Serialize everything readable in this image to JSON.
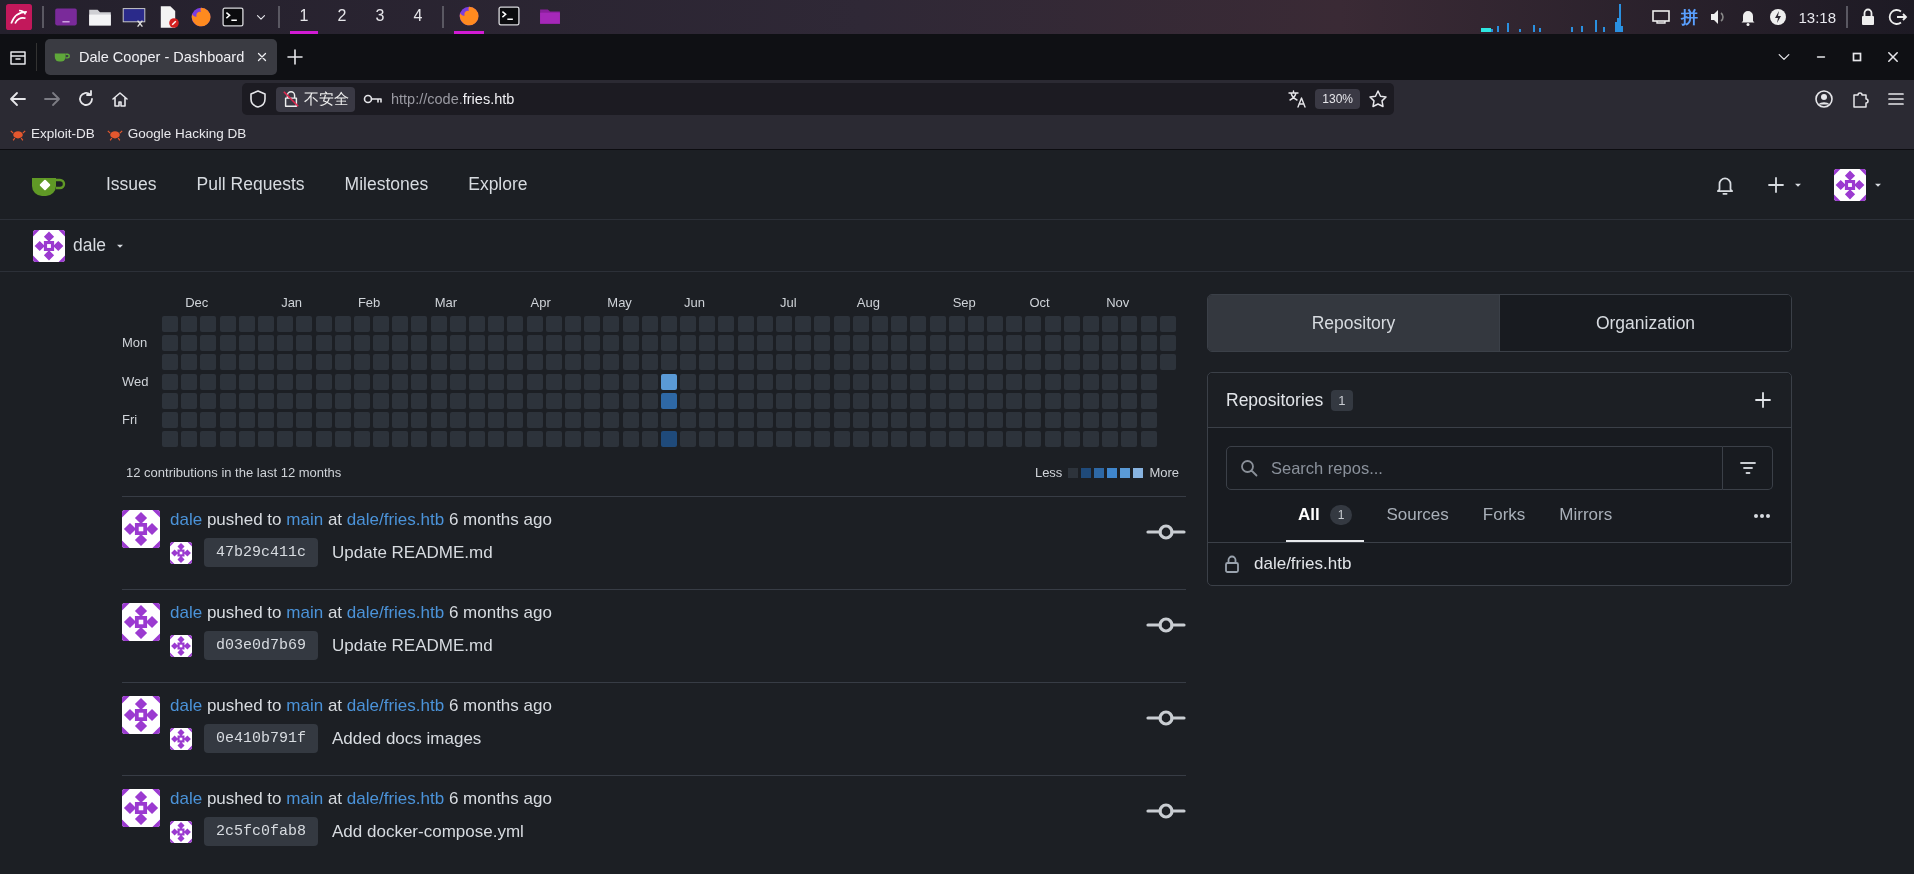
{
  "taskbar": {
    "workspaces": [
      {
        "label": "1",
        "selected": true
      },
      {
        "label": "2",
        "selected": false
      },
      {
        "label": "3",
        "selected": false
      },
      {
        "label": "4",
        "selected": false
      }
    ],
    "windows": [
      {
        "kind": "browser",
        "active": true
      },
      {
        "kind": "terminal",
        "active": false
      },
      {
        "kind": "folder",
        "active": false
      }
    ],
    "ime": "拼",
    "clock": "13:18"
  },
  "browser": {
    "tab_title": "Dale Cooper - Dashboard",
    "forward": {
      "disabled": true
    },
    "security_label": "不安全",
    "url_prefix": "http://code.",
    "url_host": "fries.htb",
    "zoom": "130%",
    "bookmarks": [
      "Exploit-DB",
      "Google Hacking DB"
    ]
  },
  "nav": {
    "items": [
      "Issues",
      "Pull Requests",
      "Milestones",
      "Explore"
    ]
  },
  "context": {
    "user": "dale"
  },
  "heatmap": {
    "day_labels": [
      "Mon",
      "Wed",
      "Fri"
    ],
    "weeks": [
      {
        "days": [
          {
            "color": "#2d333b"
          },
          {
            "color": "#2d333b"
          },
          {
            "color": "#2d333b"
          },
          {
            "color": "#2d333b"
          },
          {
            "color": "#2d333b"
          },
          {
            "color": "#2d333b"
          },
          {
            "color": "#2d333b"
          }
        ]
      },
      {
        "month": "Dec",
        "days": [
          {
            "color": "#2d333b"
          },
          {
            "color": "#2d333b"
          },
          {
            "color": "#2d333b"
          },
          {
            "color": "#2d333b"
          },
          {
            "color": "#2d333b"
          },
          {
            "color": "#2d333b"
          },
          {
            "color": "#2d333b"
          }
        ]
      },
      {
        "days": [
          {
            "color": "#2d333b"
          },
          {
            "color": "#2d333b"
          },
          {
            "color": "#2d333b"
          },
          {
            "color": "#2d333b"
          },
          {
            "color": "#2d333b"
          },
          {
            "color": "#2d333b"
          },
          {
            "color": "#2d333b"
          }
        ]
      },
      {
        "days": [
          {
            "color": "#2d333b"
          },
          {
            "color": "#2d333b"
          },
          {
            "color": "#2d333b"
          },
          {
            "color": "#2d333b"
          },
          {
            "color": "#2d333b"
          },
          {
            "color": "#2d333b"
          },
          {
            "color": "#2d333b"
          }
        ]
      },
      {
        "days": [
          {
            "color": "#2d333b"
          },
          {
            "color": "#2d333b"
          },
          {
            "color": "#2d333b"
          },
          {
            "color": "#2d333b"
          },
          {
            "color": "#2d333b"
          },
          {
            "color": "#2d333b"
          },
          {
            "color": "#2d333b"
          }
        ]
      },
      {
        "days": [
          {
            "color": "#2d333b"
          },
          {
            "color": "#2d333b"
          },
          {
            "color": "#2d333b"
          },
          {
            "color": "#2d333b"
          },
          {
            "color": "#2d333b"
          },
          {
            "color": "#2d333b"
          },
          {
            "color": "#2d333b"
          }
        ]
      },
      {
        "month": "Jan",
        "days": [
          {
            "color": "#2d333b"
          },
          {
            "color": "#2d333b"
          },
          {
            "color": "#2d333b"
          },
          {
            "color": "#2d333b"
          },
          {
            "color": "#2d333b"
          },
          {
            "color": "#2d333b"
          },
          {
            "color": "#2d333b"
          }
        ]
      },
      {
        "days": [
          {
            "color": "#2d333b"
          },
          {
            "color": "#2d333b"
          },
          {
            "color": "#2d333b"
          },
          {
            "color": "#2d333b"
          },
          {
            "color": "#2d333b"
          },
          {
            "color": "#2d333b"
          },
          {
            "color": "#2d333b"
          }
        ]
      },
      {
        "days": [
          {
            "color": "#2d333b"
          },
          {
            "color": "#2d333b"
          },
          {
            "color": "#2d333b"
          },
          {
            "color": "#2d333b"
          },
          {
            "color": "#2d333b"
          },
          {
            "color": "#2d333b"
          },
          {
            "color": "#2d333b"
          }
        ]
      },
      {
        "days": [
          {
            "color": "#2d333b"
          },
          {
            "color": "#2d333b"
          },
          {
            "color": "#2d333b"
          },
          {
            "color": "#2d333b"
          },
          {
            "color": "#2d333b"
          },
          {
            "color": "#2d333b"
          },
          {
            "color": "#2d333b"
          }
        ]
      },
      {
        "month": "Feb",
        "days": [
          {
            "color": "#2d333b"
          },
          {
            "color": "#2d333b"
          },
          {
            "color": "#2d333b"
          },
          {
            "color": "#2d333b"
          },
          {
            "color": "#2d333b"
          },
          {
            "color": "#2d333b"
          },
          {
            "color": "#2d333b"
          }
        ]
      },
      {
        "days": [
          {
            "color": "#2d333b"
          },
          {
            "color": "#2d333b"
          },
          {
            "color": "#2d333b"
          },
          {
            "color": "#2d333b"
          },
          {
            "color": "#2d333b"
          },
          {
            "color": "#2d333b"
          },
          {
            "color": "#2d333b"
          }
        ]
      },
      {
        "days": [
          {
            "color": "#2d333b"
          },
          {
            "color": "#2d333b"
          },
          {
            "color": "#2d333b"
          },
          {
            "color": "#2d333b"
          },
          {
            "color": "#2d333b"
          },
          {
            "color": "#2d333b"
          },
          {
            "color": "#2d333b"
          }
        ]
      },
      {
        "days": [
          {
            "color": "#2d333b"
          },
          {
            "color": "#2d333b"
          },
          {
            "color": "#2d333b"
          },
          {
            "color": "#2d333b"
          },
          {
            "color": "#2d333b"
          },
          {
            "color": "#2d333b"
          },
          {
            "color": "#2d333b"
          }
        ]
      },
      {
        "month": "Mar",
        "days": [
          {
            "color": "#2d333b"
          },
          {
            "color": "#2d333b"
          },
          {
            "color": "#2d333b"
          },
          {
            "color": "#2d333b"
          },
          {
            "color": "#2d333b"
          },
          {
            "color": "#2d333b"
          },
          {
            "color": "#2d333b"
          }
        ]
      },
      {
        "days": [
          {
            "color": "#2d333b"
          },
          {
            "color": "#2d333b"
          },
          {
            "color": "#2d333b"
          },
          {
            "color": "#2d333b"
          },
          {
            "color": "#2d333b"
          },
          {
            "color": "#2d333b"
          },
          {
            "color": "#2d333b"
          }
        ]
      },
      {
        "days": [
          {
            "color": "#2d333b"
          },
          {
            "color": "#2d333b"
          },
          {
            "color": "#2d333b"
          },
          {
            "color": "#2d333b"
          },
          {
            "color": "#2d333b"
          },
          {
            "color": "#2d333b"
          },
          {
            "color": "#2d333b"
          }
        ]
      },
      {
        "days": [
          {
            "color": "#2d333b"
          },
          {
            "color": "#2d333b"
          },
          {
            "color": "#2d333b"
          },
          {
            "color": "#2d333b"
          },
          {
            "color": "#2d333b"
          },
          {
            "color": "#2d333b"
          },
          {
            "color": "#2d333b"
          }
        ]
      },
      {
        "days": [
          {
            "color": "#2d333b"
          },
          {
            "color": "#2d333b"
          },
          {
            "color": "#2d333b"
          },
          {
            "color": "#2d333b"
          },
          {
            "color": "#2d333b"
          },
          {
            "color": "#2d333b"
          },
          {
            "color": "#2d333b"
          }
        ]
      },
      {
        "month": "Apr",
        "days": [
          {
            "color": "#2d333b"
          },
          {
            "color": "#2d333b"
          },
          {
            "color": "#2d333b"
          },
          {
            "color": "#2d333b"
          },
          {
            "color": "#2d333b"
          },
          {
            "color": "#2d333b"
          },
          {
            "color": "#2d333b"
          }
        ]
      },
      {
        "days": [
          {
            "color": "#2d333b"
          },
          {
            "color": "#2d333b"
          },
          {
            "color": "#2d333b"
          },
          {
            "color": "#2d333b"
          },
          {
            "color": "#2d333b"
          },
          {
            "color": "#2d333b"
          },
          {
            "color": "#2d333b"
          }
        ]
      },
      {
        "days": [
          {
            "color": "#2d333b"
          },
          {
            "color": "#2d333b"
          },
          {
            "color": "#2d333b"
          },
          {
            "color": "#2d333b"
          },
          {
            "color": "#2d333b"
          },
          {
            "color": "#2d333b"
          },
          {
            "color": "#2d333b"
          }
        ]
      },
      {
        "days": [
          {
            "color": "#2d333b"
          },
          {
            "color": "#2d333b"
          },
          {
            "color": "#2d333b"
          },
          {
            "color": "#2d333b"
          },
          {
            "color": "#2d333b"
          },
          {
            "color": "#2d333b"
          },
          {
            "color": "#2d333b"
          }
        ]
      },
      {
        "month": "May",
        "days": [
          {
            "color": "#2d333b"
          },
          {
            "color": "#2d333b"
          },
          {
            "color": "#2d333b"
          },
          {
            "color": "#2d333b"
          },
          {
            "color": "#2d333b"
          },
          {
            "color": "#2d333b"
          },
          {
            "color": "#2d333b"
          }
        ]
      },
      {
        "days": [
          {
            "color": "#2d333b"
          },
          {
            "color": "#2d333b"
          },
          {
            "color": "#2d333b"
          },
          {
            "color": "#2d333b"
          },
          {
            "color": "#2d333b"
          },
          {
            "color": "#2d333b"
          },
          {
            "color": "#2d333b"
          }
        ]
      },
      {
        "days": [
          {
            "color": "#2d333b"
          },
          {
            "color": "#2d333b"
          },
          {
            "color": "#2d333b"
          },
          {
            "color": "#2d333b"
          },
          {
            "color": "#2d333b"
          },
          {
            "color": "#2d333b"
          },
          {
            "color": "#2d333b"
          }
        ]
      },
      {
        "days": [
          {
            "color": "#2d333b"
          },
          {
            "color": "#2d333b"
          },
          {
            "color": "#2d333b"
          },
          {
            "color": "#5a9ad6"
          },
          {
            "color": "#2e68a5"
          },
          {
            "color": "#2d333b"
          },
          {
            "color": "#1f4a7a"
          }
        ]
      },
      {
        "month": "Jun",
        "days": [
          {
            "color": "#2d333b"
          },
          {
            "color": "#2d333b"
          },
          {
            "color": "#2d333b"
          },
          {
            "color": "#2d333b"
          },
          {
            "color": "#2d333b"
          },
          {
            "color": "#2d333b"
          },
          {
            "color": "#2d333b"
          }
        ]
      },
      {
        "days": [
          {
            "color": "#2d333b"
          },
          {
            "color": "#2d333b"
          },
          {
            "color": "#2d333b"
          },
          {
            "color": "#2d333b"
          },
          {
            "color": "#2d333b"
          },
          {
            "color": "#2d333b"
          },
          {
            "color": "#2d333b"
          }
        ]
      },
      {
        "days": [
          {
            "color": "#2d333b"
          },
          {
            "color": "#2d333b"
          },
          {
            "color": "#2d333b"
          },
          {
            "color": "#2d333b"
          },
          {
            "color": "#2d333b"
          },
          {
            "color": "#2d333b"
          },
          {
            "color": "#2d333b"
          }
        ]
      },
      {
        "days": [
          {
            "color": "#2d333b"
          },
          {
            "color": "#2d333b"
          },
          {
            "color": "#2d333b"
          },
          {
            "color": "#2d333b"
          },
          {
            "color": "#2d333b"
          },
          {
            "color": "#2d333b"
          },
          {
            "color": "#2d333b"
          }
        ]
      },
      {
        "days": [
          {
            "color": "#2d333b"
          },
          {
            "color": "#2d333b"
          },
          {
            "color": "#2d333b"
          },
          {
            "color": "#2d333b"
          },
          {
            "color": "#2d333b"
          },
          {
            "color": "#2d333b"
          },
          {
            "color": "#2d333b"
          }
        ]
      },
      {
        "month": "Jul",
        "days": [
          {
            "color": "#2d333b"
          },
          {
            "color": "#2d333b"
          },
          {
            "color": "#2d333b"
          },
          {
            "color": "#2d333b"
          },
          {
            "color": "#2d333b"
          },
          {
            "color": "#2d333b"
          },
          {
            "color": "#2d333b"
          }
        ]
      },
      {
        "days": [
          {
            "color": "#2d333b"
          },
          {
            "color": "#2d333b"
          },
          {
            "color": "#2d333b"
          },
          {
            "color": "#2d333b"
          },
          {
            "color": "#2d333b"
          },
          {
            "color": "#2d333b"
          },
          {
            "color": "#2d333b"
          }
        ]
      },
      {
        "days": [
          {
            "color": "#2d333b"
          },
          {
            "color": "#2d333b"
          },
          {
            "color": "#2d333b"
          },
          {
            "color": "#2d333b"
          },
          {
            "color": "#2d333b"
          },
          {
            "color": "#2d333b"
          },
          {
            "color": "#2d333b"
          }
        ]
      },
      {
        "days": [
          {
            "color": "#2d333b"
          },
          {
            "color": "#2d333b"
          },
          {
            "color": "#2d333b"
          },
          {
            "color": "#2d333b"
          },
          {
            "color": "#2d333b"
          },
          {
            "color": "#2d333b"
          },
          {
            "color": "#2d333b"
          }
        ]
      },
      {
        "month": "Aug",
        "days": [
          {
            "color": "#2d333b"
          },
          {
            "color": "#2d333b"
          },
          {
            "color": "#2d333b"
          },
          {
            "color": "#2d333b"
          },
          {
            "color": "#2d333b"
          },
          {
            "color": "#2d333b"
          },
          {
            "color": "#2d333b"
          }
        ]
      },
      {
        "days": [
          {
            "color": "#2d333b"
          },
          {
            "color": "#2d333b"
          },
          {
            "color": "#2d333b"
          },
          {
            "color": "#2d333b"
          },
          {
            "color": "#2d333b"
          },
          {
            "color": "#2d333b"
          },
          {
            "color": "#2d333b"
          }
        ]
      },
      {
        "days": [
          {
            "color": "#2d333b"
          },
          {
            "color": "#2d333b"
          },
          {
            "color": "#2d333b"
          },
          {
            "color": "#2d333b"
          },
          {
            "color": "#2d333b"
          },
          {
            "color": "#2d333b"
          },
          {
            "color": "#2d333b"
          }
        ]
      },
      {
        "days": [
          {
            "color": "#2d333b"
          },
          {
            "color": "#2d333b"
          },
          {
            "color": "#2d333b"
          },
          {
            "color": "#2d333b"
          },
          {
            "color": "#2d333b"
          },
          {
            "color": "#2d333b"
          },
          {
            "color": "#2d333b"
          }
        ]
      },
      {
        "days": [
          {
            "color": "#2d333b"
          },
          {
            "color": "#2d333b"
          },
          {
            "color": "#2d333b"
          },
          {
            "color": "#2d333b"
          },
          {
            "color": "#2d333b"
          },
          {
            "color": "#2d333b"
          },
          {
            "color": "#2d333b"
          }
        ]
      },
      {
        "month": "Sep",
        "days": [
          {
            "color": "#2d333b"
          },
          {
            "color": "#2d333b"
          },
          {
            "color": "#2d333b"
          },
          {
            "color": "#2d333b"
          },
          {
            "color": "#2d333b"
          },
          {
            "color": "#2d333b"
          },
          {
            "color": "#2d333b"
          }
        ]
      },
      {
        "days": [
          {
            "color": "#2d333b"
          },
          {
            "color": "#2d333b"
          },
          {
            "color": "#2d333b"
          },
          {
            "color": "#2d333b"
          },
          {
            "color": "#2d333b"
          },
          {
            "color": "#2d333b"
          },
          {
            "color": "#2d333b"
          }
        ]
      },
      {
        "days": [
          {
            "color": "#2d333b"
          },
          {
            "color": "#2d333b"
          },
          {
            "color": "#2d333b"
          },
          {
            "color": "#2d333b"
          },
          {
            "color": "#2d333b"
          },
          {
            "color": "#2d333b"
          },
          {
            "color": "#2d333b"
          }
        ]
      },
      {
        "days": [
          {
            "color": "#2d333b"
          },
          {
            "color": "#2d333b"
          },
          {
            "color": "#2d333b"
          },
          {
            "color": "#2d333b"
          },
          {
            "color": "#2d333b"
          },
          {
            "color": "#2d333b"
          },
          {
            "color": "#2d333b"
          }
        ]
      },
      {
        "month": "Oct",
        "days": [
          {
            "color": "#2d333b"
          },
          {
            "color": "#2d333b"
          },
          {
            "color": "#2d333b"
          },
          {
            "color": "#2d333b"
          },
          {
            "color": "#2d333b"
          },
          {
            "color": "#2d333b"
          },
          {
            "color": "#2d333b"
          }
        ]
      },
      {
        "days": [
          {
            "color": "#2d333b"
          },
          {
            "color": "#2d333b"
          },
          {
            "color": "#2d333b"
          },
          {
            "color": "#2d333b"
          },
          {
            "color": "#2d333b"
          },
          {
            "color": "#2d333b"
          },
          {
            "color": "#2d333b"
          }
        ]
      },
      {
        "days": [
          {
            "color": "#2d333b"
          },
          {
            "color": "#2d333b"
          },
          {
            "color": "#2d333b"
          },
          {
            "color": "#2d333b"
          },
          {
            "color": "#2d333b"
          },
          {
            "color": "#2d333b"
          },
          {
            "color": "#2d333b"
          }
        ]
      },
      {
        "days": [
          {
            "color": "#2d333b"
          },
          {
            "color": "#2d333b"
          },
          {
            "color": "#2d333b"
          },
          {
            "color": "#2d333b"
          },
          {
            "color": "#2d333b"
          },
          {
            "color": "#2d333b"
          },
          {
            "color": "#2d333b"
          }
        ]
      },
      {
        "month": "Nov",
        "days": [
          {
            "color": "#2d333b"
          },
          {
            "color": "#2d333b"
          },
          {
            "color": "#2d333b"
          },
          {
            "color": "#2d333b"
          },
          {
            "color": "#2d333b"
          },
          {
            "color": "#2d333b"
          },
          {
            "color": "#2d333b"
          }
        ]
      },
      {
        "days": [
          {
            "color": "#2d333b"
          },
          {
            "color": "#2d333b"
          },
          {
            "color": "#2d333b"
          },
          {
            "color": "#2d333b"
          },
          {
            "color": "#2d333b"
          },
          {
            "color": "#2d333b"
          },
          {
            "color": "#2d333b"
          }
        ]
      },
      {
        "days": [
          {
            "color": "#2d333b"
          },
          {
            "color": "#2d333b"
          },
          {
            "color": "#2d333b"
          },
          {
            "color": "#2d333b"
          },
          {
            "color": "#2d333b"
          },
          {
            "color": "#2d333b"
          },
          {
            "color": "#2d333b"
          }
        ]
      },
      {
        "days": [
          {
            "color": "#2d333b"
          },
          {
            "color": "#2d333b"
          },
          {
            "color": "#2d333b"
          }
        ]
      }
    ],
    "summary": "12 contributions in the last 12 months",
    "legend_less": "Less",
    "legend_more": "More",
    "legend": [
      {
        "color": "#2d333b"
      },
      {
        "color": "#1f4a7a"
      },
      {
        "color": "#2e68a5"
      },
      {
        "color": "#3f86cd"
      },
      {
        "color": "#5a9ad6"
      },
      {
        "color": "#87b3e0"
      }
    ]
  },
  "feed": [
    {
      "user": "dale",
      "action": "pushed to",
      "branch": "main",
      "preposition": "at",
      "repo": "dale/fries.htb",
      "time": "6 months ago",
      "sha": "47b29c411c",
      "message": "Update README.md"
    },
    {
      "user": "dale",
      "action": "pushed to",
      "branch": "main",
      "preposition": "at",
      "repo": "dale/fries.htb",
      "time": "6 months ago",
      "sha": "d03e0d7b69",
      "message": "Update README.md"
    },
    {
      "user": "dale",
      "action": "pushed to",
      "branch": "main",
      "preposition": "at",
      "repo": "dale/fries.htb",
      "time": "6 months ago",
      "sha": "0e410b791f",
      "message": "Added docs images"
    },
    {
      "user": "dale",
      "action": "pushed to",
      "branch": "main",
      "preposition": "at",
      "repo": "dale/fries.htb",
      "time": "6 months ago",
      "sha": "2c5fc0fab8",
      "message": "Add docker-compose.yml"
    }
  ],
  "dashboard_tabs": [
    {
      "label": "Repository",
      "selected": true
    },
    {
      "label": "Organization",
      "selected": false
    }
  ],
  "repos": {
    "title": "Repositories",
    "count": "1",
    "search_placeholder": "Search repos...",
    "filters": [
      {
        "label": "All",
        "count": "1",
        "selected": true
      },
      {
        "label": "Sources",
        "selected": false
      },
      {
        "label": "Forks",
        "selected": false
      },
      {
        "label": "Mirrors",
        "selected": false
      }
    ],
    "items": [
      {
        "name": "dale/fries.htb",
        "private": true
      }
    ]
  }
}
